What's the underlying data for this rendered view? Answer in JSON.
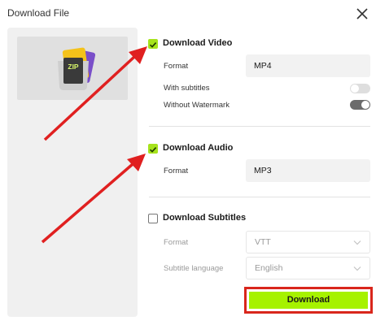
{
  "window": {
    "title": "Download File"
  },
  "video": {
    "label": "Download Video",
    "checked": true,
    "format_label": "Format",
    "format_value": "MP4",
    "subtitles_label": "With subtitles",
    "subtitles_on": false,
    "watermark_label": "Without Watermark",
    "watermark_on": true
  },
  "audio": {
    "label": "Download Audio",
    "checked": true,
    "format_label": "Format",
    "format_value": "MP3"
  },
  "subtitles": {
    "label": "Download Subtitles",
    "checked": false,
    "format_label": "Format",
    "format_value": "VTT",
    "language_label": "Subtitle language",
    "language_value": "English"
  },
  "thumbnail": {
    "badge": "ZIP"
  },
  "actions": {
    "download_label": "Download"
  },
  "colors": {
    "accent": "#a6f200",
    "check": "#a6e31c",
    "highlight": "#d9261c"
  }
}
